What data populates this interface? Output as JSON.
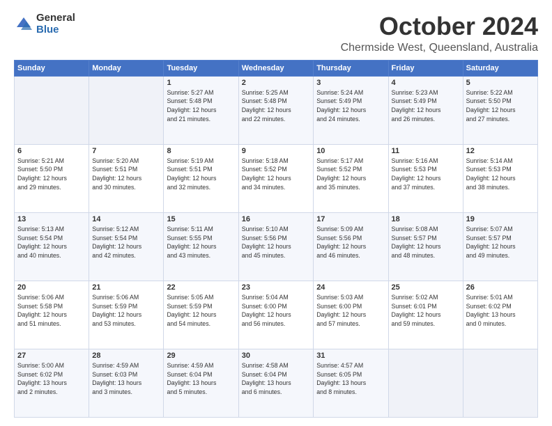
{
  "header": {
    "logo_general": "General",
    "logo_blue": "Blue",
    "title": "October 2024",
    "subtitle": "Chermside West, Queensland, Australia"
  },
  "calendar": {
    "headers": [
      "Sunday",
      "Monday",
      "Tuesday",
      "Wednesday",
      "Thursday",
      "Friday",
      "Saturday"
    ],
    "weeks": [
      [
        {
          "day": "",
          "info": ""
        },
        {
          "day": "",
          "info": ""
        },
        {
          "day": "1",
          "info": "Sunrise: 5:27 AM\nSunset: 5:48 PM\nDaylight: 12 hours\nand 21 minutes."
        },
        {
          "day": "2",
          "info": "Sunrise: 5:25 AM\nSunset: 5:48 PM\nDaylight: 12 hours\nand 22 minutes."
        },
        {
          "day": "3",
          "info": "Sunrise: 5:24 AM\nSunset: 5:49 PM\nDaylight: 12 hours\nand 24 minutes."
        },
        {
          "day": "4",
          "info": "Sunrise: 5:23 AM\nSunset: 5:49 PM\nDaylight: 12 hours\nand 26 minutes."
        },
        {
          "day": "5",
          "info": "Sunrise: 5:22 AM\nSunset: 5:50 PM\nDaylight: 12 hours\nand 27 minutes."
        }
      ],
      [
        {
          "day": "6",
          "info": "Sunrise: 5:21 AM\nSunset: 5:50 PM\nDaylight: 12 hours\nand 29 minutes."
        },
        {
          "day": "7",
          "info": "Sunrise: 5:20 AM\nSunset: 5:51 PM\nDaylight: 12 hours\nand 30 minutes."
        },
        {
          "day": "8",
          "info": "Sunrise: 5:19 AM\nSunset: 5:51 PM\nDaylight: 12 hours\nand 32 minutes."
        },
        {
          "day": "9",
          "info": "Sunrise: 5:18 AM\nSunset: 5:52 PM\nDaylight: 12 hours\nand 34 minutes."
        },
        {
          "day": "10",
          "info": "Sunrise: 5:17 AM\nSunset: 5:52 PM\nDaylight: 12 hours\nand 35 minutes."
        },
        {
          "day": "11",
          "info": "Sunrise: 5:16 AM\nSunset: 5:53 PM\nDaylight: 12 hours\nand 37 minutes."
        },
        {
          "day": "12",
          "info": "Sunrise: 5:14 AM\nSunset: 5:53 PM\nDaylight: 12 hours\nand 38 minutes."
        }
      ],
      [
        {
          "day": "13",
          "info": "Sunrise: 5:13 AM\nSunset: 5:54 PM\nDaylight: 12 hours\nand 40 minutes."
        },
        {
          "day": "14",
          "info": "Sunrise: 5:12 AM\nSunset: 5:54 PM\nDaylight: 12 hours\nand 42 minutes."
        },
        {
          "day": "15",
          "info": "Sunrise: 5:11 AM\nSunset: 5:55 PM\nDaylight: 12 hours\nand 43 minutes."
        },
        {
          "day": "16",
          "info": "Sunrise: 5:10 AM\nSunset: 5:56 PM\nDaylight: 12 hours\nand 45 minutes."
        },
        {
          "day": "17",
          "info": "Sunrise: 5:09 AM\nSunset: 5:56 PM\nDaylight: 12 hours\nand 46 minutes."
        },
        {
          "day": "18",
          "info": "Sunrise: 5:08 AM\nSunset: 5:57 PM\nDaylight: 12 hours\nand 48 minutes."
        },
        {
          "day": "19",
          "info": "Sunrise: 5:07 AM\nSunset: 5:57 PM\nDaylight: 12 hours\nand 49 minutes."
        }
      ],
      [
        {
          "day": "20",
          "info": "Sunrise: 5:06 AM\nSunset: 5:58 PM\nDaylight: 12 hours\nand 51 minutes."
        },
        {
          "day": "21",
          "info": "Sunrise: 5:06 AM\nSunset: 5:59 PM\nDaylight: 12 hours\nand 53 minutes."
        },
        {
          "day": "22",
          "info": "Sunrise: 5:05 AM\nSunset: 5:59 PM\nDaylight: 12 hours\nand 54 minutes."
        },
        {
          "day": "23",
          "info": "Sunrise: 5:04 AM\nSunset: 6:00 PM\nDaylight: 12 hours\nand 56 minutes."
        },
        {
          "day": "24",
          "info": "Sunrise: 5:03 AM\nSunset: 6:00 PM\nDaylight: 12 hours\nand 57 minutes."
        },
        {
          "day": "25",
          "info": "Sunrise: 5:02 AM\nSunset: 6:01 PM\nDaylight: 12 hours\nand 59 minutes."
        },
        {
          "day": "26",
          "info": "Sunrise: 5:01 AM\nSunset: 6:02 PM\nDaylight: 13 hours\nand 0 minutes."
        }
      ],
      [
        {
          "day": "27",
          "info": "Sunrise: 5:00 AM\nSunset: 6:02 PM\nDaylight: 13 hours\nand 2 minutes."
        },
        {
          "day": "28",
          "info": "Sunrise: 4:59 AM\nSunset: 6:03 PM\nDaylight: 13 hours\nand 3 minutes."
        },
        {
          "day": "29",
          "info": "Sunrise: 4:59 AM\nSunset: 6:04 PM\nDaylight: 13 hours\nand 5 minutes."
        },
        {
          "day": "30",
          "info": "Sunrise: 4:58 AM\nSunset: 6:04 PM\nDaylight: 13 hours\nand 6 minutes."
        },
        {
          "day": "31",
          "info": "Sunrise: 4:57 AM\nSunset: 6:05 PM\nDaylight: 13 hours\nand 8 minutes."
        },
        {
          "day": "",
          "info": ""
        },
        {
          "day": "",
          "info": ""
        }
      ]
    ]
  }
}
